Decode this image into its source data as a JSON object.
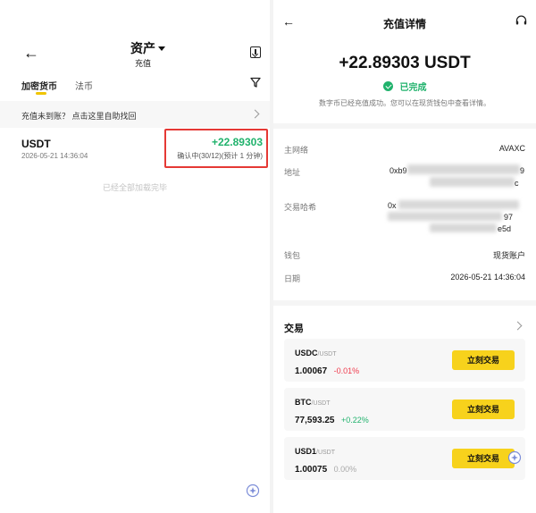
{
  "left": {
    "back_glyph": "←",
    "title": "资产",
    "subtitle": "充值",
    "tabs": [
      {
        "label": "加密货币",
        "active": true
      },
      {
        "label": "法币",
        "active": false
      }
    ],
    "banner_text": "充值未到账？ 点击这里自助找回",
    "record": {
      "coin": "USDT",
      "timestamp": "2026-05-21 14:36:04",
      "amount": "+22.89303",
      "confirm": "确认中(30/12)(预计 1 分钟)"
    },
    "loaded_text": "已经全部加载完毕",
    "icons": [
      "back-arrow-icon",
      "dropdown-caret-icon",
      "download-icon",
      "filter-icon",
      "chevron-right-icon",
      "sparkle-icon"
    ]
  },
  "right": {
    "back_glyph": "←",
    "title": "充值详情",
    "amount": "+22.89303 USDT",
    "status": "已完成",
    "description": "数字币已经充值成功。您可以在现货钱包中查看详情。",
    "details": {
      "network_label": "主网络",
      "network_value": "AVAXC",
      "address_label": "地址",
      "address_start": "0xb9",
      "address_tail": "c",
      "address_end_char": "9",
      "hash_label": "交易哈希",
      "hash_start": "0x",
      "hash_tail": "e5d",
      "hash_mid_char": "97",
      "wallet_label": "钱包",
      "wallet_value": "现货账户",
      "date_label": "日期",
      "date_value": "2026-05-21 14:36:04"
    },
    "trade_section": {
      "title": "交易",
      "button_label": "立刻交易",
      "pairs": [
        {
          "base": "USDC",
          "quote": "/USDT",
          "price": "1.00067",
          "change": "-0.01%",
          "trend": "down"
        },
        {
          "base": "BTC",
          "quote": "/USDT",
          "price": "77,593.25",
          "change": "+0.22%",
          "trend": "up"
        },
        {
          "base": "USD1",
          "quote": "/USDT",
          "price": "1.00075",
          "change": "0.00%",
          "trend": "flat"
        }
      ]
    },
    "icons": [
      "back-arrow-icon",
      "headset-icon",
      "check-circle-icon",
      "chevron-right-icon",
      "sparkle-icon"
    ]
  },
  "colors": {
    "accent_yellow": "#f7d21c",
    "green": "#20b26c",
    "red": "#ef3b4d",
    "highlight_red": "#e53935"
  }
}
